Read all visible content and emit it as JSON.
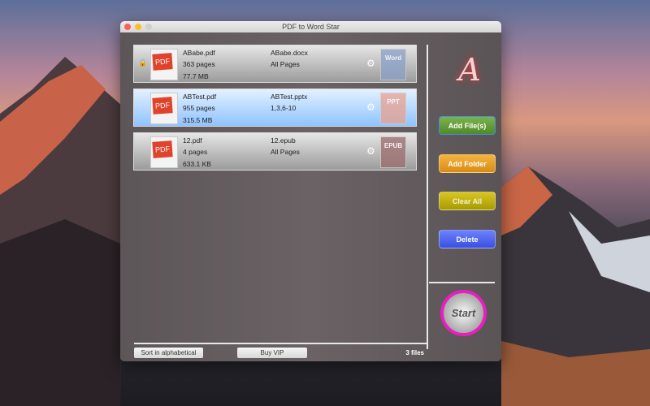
{
  "window": {
    "title": "PDF to Word Star"
  },
  "files": [
    {
      "name": "ABabe.pdf",
      "pages": "363 pages",
      "size": "77.7 MB",
      "output": "ABabe.docx",
      "range": "All Pages",
      "format": "Word",
      "locked": true
    },
    {
      "name": "ABTest.pdf",
      "pages": "955 pages",
      "size": "315.5 MB",
      "output": "ABTest.pptx",
      "range": "1,3,6-10",
      "format": "PPT",
      "selected": true
    },
    {
      "name": "12.pdf",
      "pages": "4 pages",
      "size": "633.1 KB",
      "output": "12.epub",
      "range": "All Pages",
      "format": "EPUB"
    }
  ],
  "pdf_label": "PDF",
  "buttons": {
    "add_files": "Add File(s)",
    "add_folder": "Add Folder",
    "clear_all": "Clear All",
    "delete": "Delete",
    "start": "Start",
    "sort": "Sort in alphabetical",
    "buy_vip": "Buy VIP"
  },
  "status": {
    "count": "3 files"
  },
  "logo": "A"
}
